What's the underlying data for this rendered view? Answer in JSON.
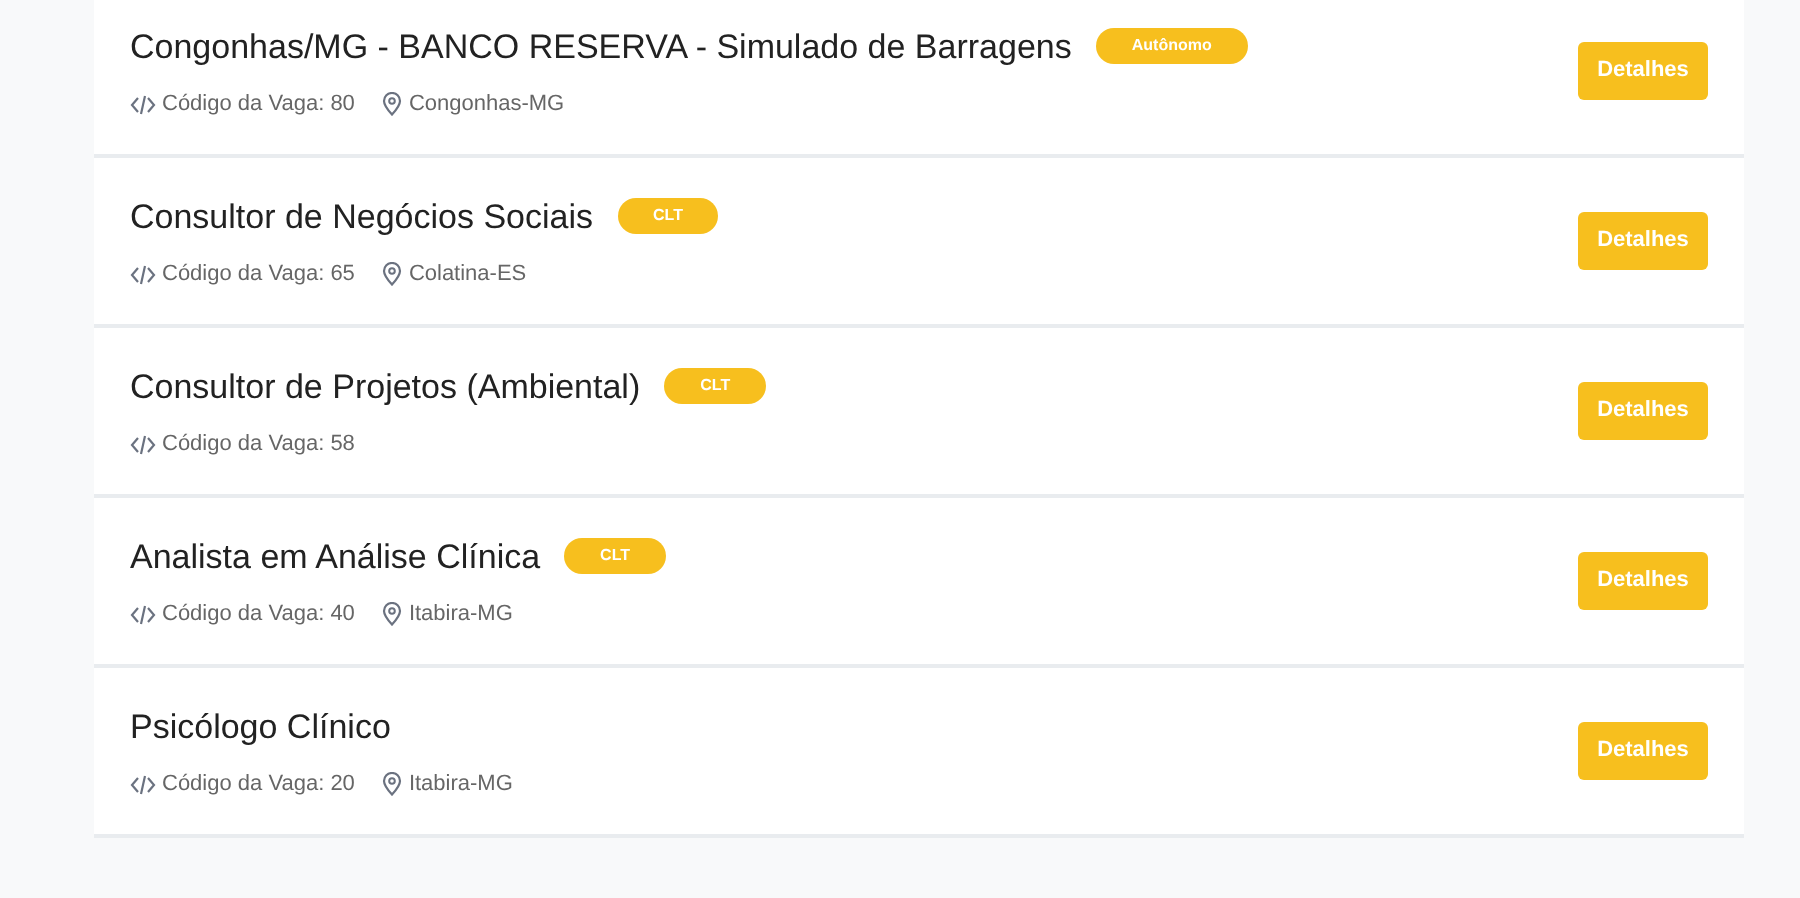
{
  "jobs": [
    {
      "title": "Congonhas/MG - BANCO RESERVA - Simulado de Barragens",
      "badge": "Autônomo",
      "code": "Código da Vaga: 80",
      "location": "Congonhas-MG",
      "button": "Detalhes"
    },
    {
      "title": "Consultor de Negócios Sociais",
      "badge": "CLT",
      "code": "Código da Vaga: 65",
      "location": "Colatina-ES",
      "button": "Detalhes"
    },
    {
      "title": "Consultor de Projetos (Ambiental)",
      "badge": "CLT",
      "code": "Código da Vaga: 58",
      "button": "Detalhes"
    },
    {
      "title": "Analista em Análise Clínica",
      "badge": "CLT",
      "code": "Código da Vaga: 40",
      "location": "Itabira-MG",
      "button": "Detalhes"
    },
    {
      "title": "Psicólogo Clínico",
      "code": "Código da Vaga: 20",
      "location": "Itabira-MG",
      "button": "Detalhes"
    }
  ]
}
